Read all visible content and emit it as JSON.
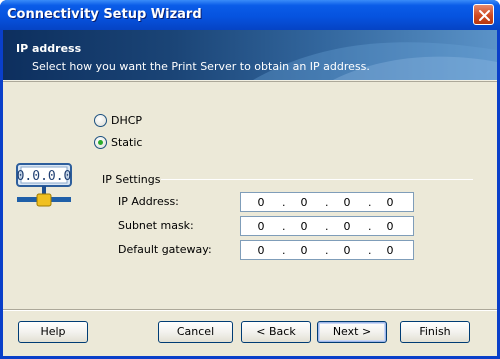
{
  "window": {
    "title": "Connectivity Setup Wizard"
  },
  "header": {
    "title": "IP address",
    "subtitle": "Select how you want the Print Server to obtain an IP address."
  },
  "mode": {
    "options": [
      {
        "label": "DHCP",
        "checked": false
      },
      {
        "label": "Static",
        "checked": true
      }
    ]
  },
  "ip_settings": {
    "group_label": "IP Settings",
    "fields": [
      {
        "label": "IP Address:",
        "octets": [
          "0",
          "0",
          "0",
          "0"
        ]
      },
      {
        "label": "Subnet mask:",
        "octets": [
          "0",
          "0",
          "0",
          "0"
        ]
      },
      {
        "label": "Default gateway:",
        "octets": [
          "0",
          "0",
          "0",
          "0"
        ]
      }
    ],
    "icon_display": "0.0.0.0"
  },
  "buttons": {
    "help": "Help",
    "cancel": "Cancel",
    "back": "< Back",
    "next": "Next >",
    "finish": "Finish"
  },
  "icons": {
    "close": "close-icon",
    "network": "network-ip-icon"
  },
  "colors": {
    "titlebar": "#0653df",
    "radio_checked": "#2bab2b",
    "header_dark": "#0d2f5e"
  }
}
